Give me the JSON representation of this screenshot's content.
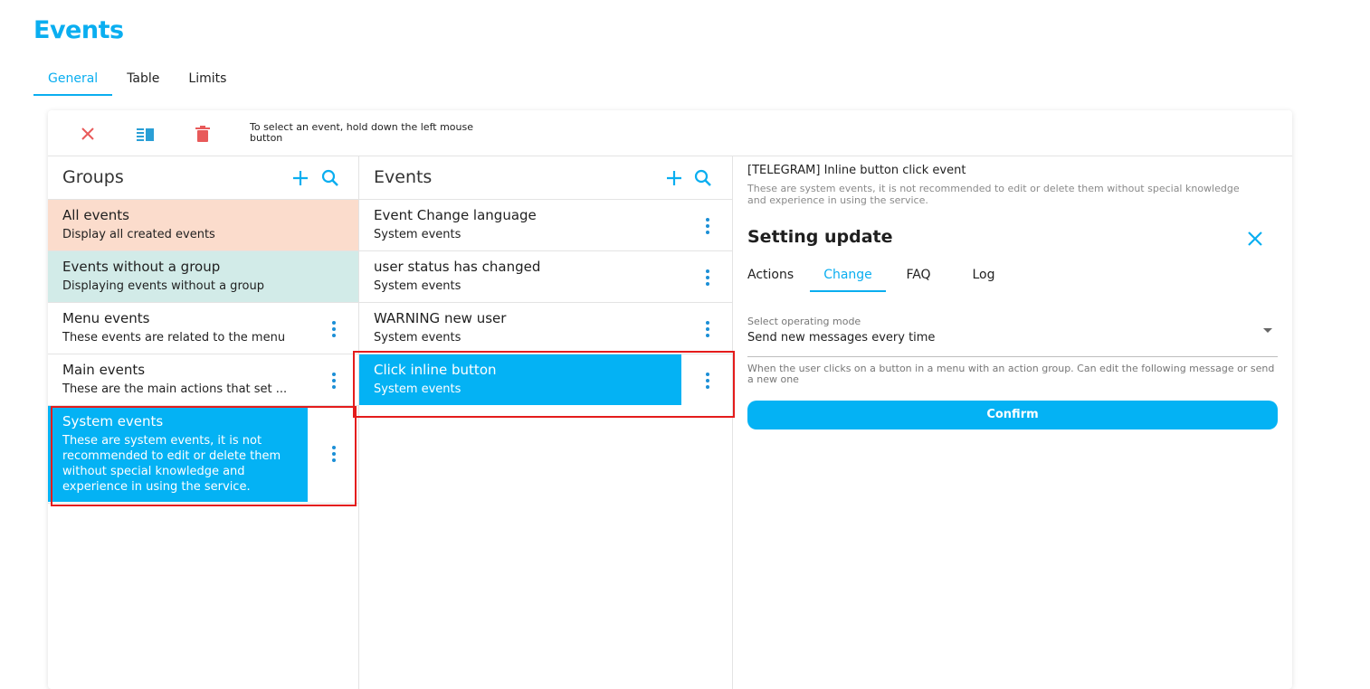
{
  "page": {
    "title": "Events"
  },
  "top_tabs": [
    {
      "label": "General",
      "active": true
    },
    {
      "label": "Table",
      "active": false
    },
    {
      "label": "Limits",
      "active": false
    }
  ],
  "toolbar": {
    "hint": "To select an event, hold down the left mouse button",
    "icons": [
      "close-icon",
      "columns-icon",
      "trash-icon"
    ]
  },
  "groups": {
    "title": "Groups",
    "items": [
      {
        "title": "All events",
        "subtitle": "Display all created events",
        "style": "peach"
      },
      {
        "title": "Events without a group",
        "subtitle": "Displaying events without a group",
        "style": "teal"
      },
      {
        "title": "Menu events",
        "subtitle": "These events are related to the menu",
        "style": "plain"
      },
      {
        "title": "Main events",
        "subtitle": "These are the main actions that set ...",
        "style": "plain"
      },
      {
        "title": "System events",
        "subtitle": "These are system events, it is not recommended to edit or delete them without special knowledge and experience in using the service.",
        "style": "selected"
      }
    ]
  },
  "events": {
    "title": "Events",
    "items": [
      {
        "title": "Event Change language",
        "subtitle": "System events"
      },
      {
        "title": "user status has changed",
        "subtitle": "System events"
      },
      {
        "title": "WARNING new user",
        "subtitle": "System events"
      },
      {
        "title": "Click inline button",
        "subtitle": "System events",
        "selected": true
      }
    ]
  },
  "detail": {
    "event_title": "[TELEGRAM] Inline button click event",
    "event_desc": "These are system events, it is not recommended to edit or delete them without special knowledge and experience in using the service.",
    "setting_title": "Setting update",
    "tabs": [
      {
        "label": "Actions",
        "active": false
      },
      {
        "label": "Change",
        "active": true
      },
      {
        "label": "FAQ",
        "active": false
      },
      {
        "label": "Log",
        "active": false
      }
    ],
    "select_label": "Select operating mode",
    "select_value": "Send new messages every time",
    "select_hint": "When the user clicks on a button in a menu with an action group. Can edit the following message or send a new one",
    "confirm_label": "Confirm"
  },
  "colors": {
    "accent": "#04b2f4",
    "peach": "#fbdccc",
    "teal": "#d2ebe8",
    "danger": "#e85a5a",
    "highlight": "#e41c1c"
  }
}
